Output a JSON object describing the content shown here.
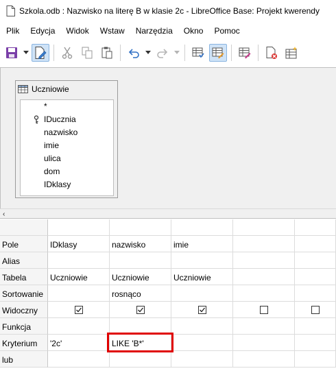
{
  "window": {
    "title": "Szkola.odb : Nazwisko na literę B w klasie 2c - LibreOffice Base: Projekt kwerendy"
  },
  "menu": [
    "Plik",
    "Edycja",
    "Widok",
    "Wstaw",
    "Narzędzia",
    "Okno",
    "Pomoc"
  ],
  "toolbar": {
    "buttons": [
      "save-icon",
      "edit-mode-icon",
      "cut-icon",
      "copy-icon",
      "paste-icon",
      "undo-icon",
      "redo-icon",
      "run-query-icon",
      "design-view-icon",
      "sql-view-icon",
      "clear-query-icon",
      "add-table-icon"
    ]
  },
  "design": {
    "table_window": {
      "title": "Uczniowie",
      "fields": [
        "*",
        "IDucznia",
        "nazwisko",
        "imie",
        "ulica",
        "dom",
        "IDklasy"
      ]
    }
  },
  "grid": {
    "row_labels": [
      "Pole",
      "Alias",
      "Tabela",
      "Sortowanie",
      "Widoczny",
      "Funkcja",
      "Kryterium",
      "lub"
    ],
    "columns": [
      {
        "pole": "IDklasy",
        "alias": "",
        "tabela": "Uczniowie",
        "sortowanie": "",
        "widoczny": true,
        "funkcja": "",
        "kryterium": "'2c'",
        "lub": ""
      },
      {
        "pole": "nazwisko",
        "alias": "",
        "tabela": "Uczniowie",
        "sortowanie": "rosnąco",
        "widoczny": true,
        "funkcja": "",
        "kryterium": "LIKE 'B*'",
        "lub": ""
      },
      {
        "pole": "imie",
        "alias": "",
        "tabela": "Uczniowie",
        "sortowanie": "",
        "widoczny": true,
        "funkcja": "",
        "kryterium": "",
        "lub": ""
      },
      {
        "pole": "",
        "alias": "",
        "tabela": "",
        "sortowanie": "",
        "widoczny": false,
        "funkcja": "",
        "kryterium": "",
        "lub": ""
      },
      {
        "pole": "",
        "alias": "",
        "tabela": "",
        "sortowanie": "",
        "widoczny": false,
        "funkcja": "",
        "kryterium": "",
        "lub": ""
      }
    ]
  },
  "colors": {
    "highlight": "#e00000",
    "active_button": "#cfe3f7",
    "design_bg": "#f0f0f0"
  }
}
